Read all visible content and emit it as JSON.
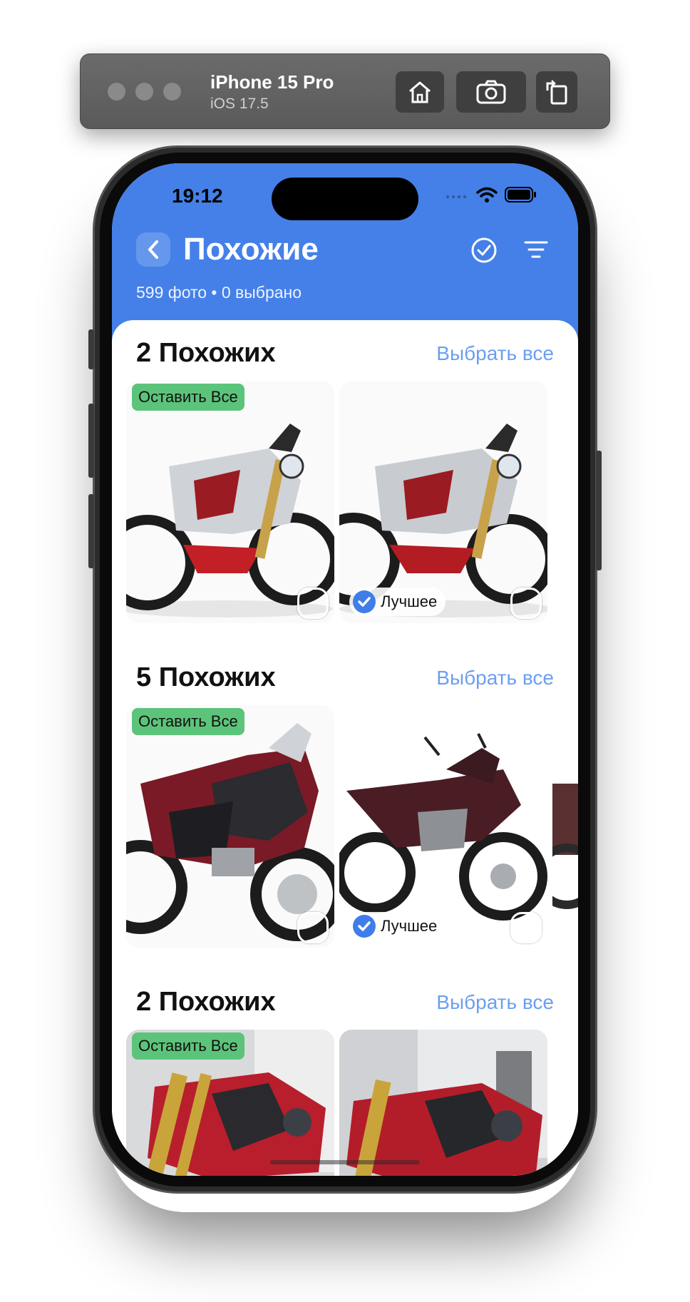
{
  "simulator": {
    "device_name": "iPhone 15 Pro",
    "os_version": "iOS 17.5",
    "buttons": [
      "home-icon",
      "screenshot-icon",
      "rotate-icon"
    ]
  },
  "status_bar": {
    "time": "19:12"
  },
  "nav": {
    "title": "Похожие",
    "subtitle": "599 фото • 0 выбрано",
    "accent_color": "#4480e8"
  },
  "groups": [
    {
      "title": "2 Похожих",
      "select_all": "Выбрать все",
      "keep_label": "Оставить Все",
      "best_label": "Лучшее"
    },
    {
      "title": "5 Похожих",
      "select_all": "Выбрать все",
      "keep_label": "Оставить Все",
      "best_label": "Лучшее"
    },
    {
      "title": "2 Похожих",
      "select_all": "Выбрать все",
      "keep_label": "Оставить Все"
    }
  ]
}
